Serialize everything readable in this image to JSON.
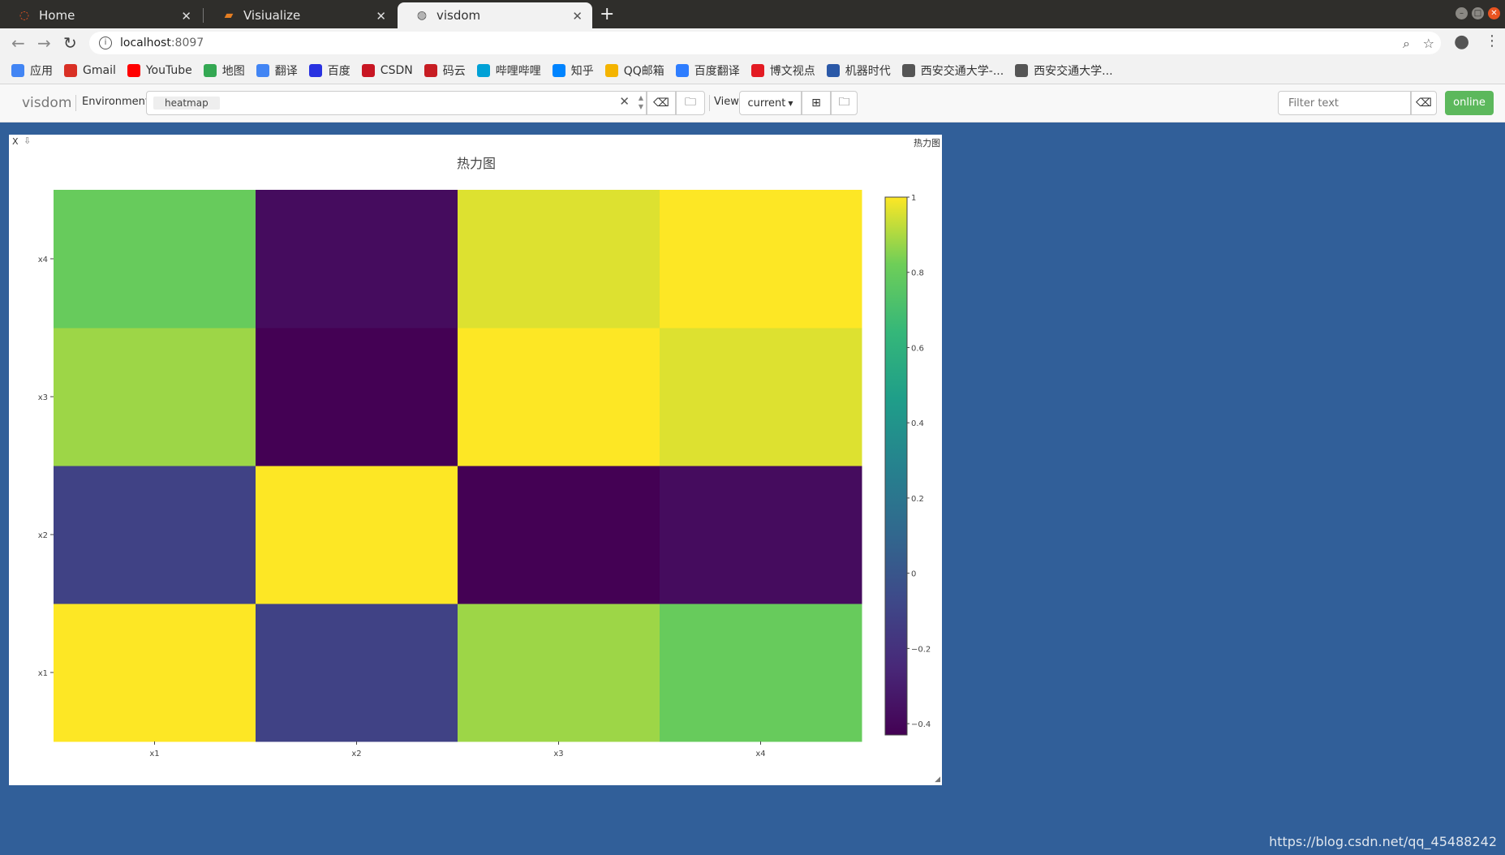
{
  "browser": {
    "tabs": [
      {
        "label": "Home",
        "icon": "ubuntu-icon"
      },
      {
        "label": "Visiualize",
        "icon": "book-icon"
      },
      {
        "label": "visdom",
        "icon": "globe-icon"
      }
    ],
    "url_host": "localhost",
    "url_port": ":8097",
    "bookmarks": [
      {
        "label": "应用",
        "icon": "apps-grid-icon",
        "color": "#4285f4"
      },
      {
        "label": "Gmail",
        "icon": "gmail-icon",
        "color": "#d93025"
      },
      {
        "label": "YouTube",
        "icon": "youtube-icon",
        "color": "#ff0000"
      },
      {
        "label": "地图",
        "icon": "maps-icon",
        "color": "#34a853"
      },
      {
        "label": "翻译",
        "icon": "translate-icon",
        "color": "#4285f4"
      },
      {
        "label": "百度",
        "icon": "baidu-paw-icon",
        "color": "#2932e1"
      },
      {
        "label": "CSDN",
        "icon": "csdn-icon",
        "color": "#c81623"
      },
      {
        "label": "码云",
        "icon": "gitee-icon",
        "color": "#c71d23"
      },
      {
        "label": "哔哩哔哩",
        "icon": "bilibili-icon",
        "color": "#00a1d6"
      },
      {
        "label": "知乎",
        "icon": "zhihu-icon",
        "color": "#0084ff"
      },
      {
        "label": "QQ邮箱",
        "icon": "qqmail-icon",
        "color": "#f4b400"
      },
      {
        "label": "百度翻译",
        "icon": "baidu-translate-icon",
        "color": "#2e7dff"
      },
      {
        "label": "博文视点",
        "icon": "bowen-icon",
        "color": "#e31b23"
      },
      {
        "label": "机器时代",
        "icon": "robot-icon",
        "color": "#2b59a8"
      },
      {
        "label": "西安交通大学-...",
        "icon": "globe-icon",
        "color": "#555555"
      },
      {
        "label": "西安交通大学...",
        "icon": "globe-icon",
        "color": "#555555"
      }
    ]
  },
  "visdom": {
    "brand": "visdom",
    "environment_label": "Environment",
    "environment_chip": "heatmap",
    "view_label": "View",
    "view_select": "current",
    "filter_placeholder": "Filter text",
    "status": "online"
  },
  "pane": {
    "close": "X",
    "title": "热力图"
  },
  "chart_data": {
    "type": "heatmap",
    "title": "热力图",
    "x": [
      "x1",
      "x2",
      "x3",
      "x4"
    ],
    "y": [
      "x1",
      "x2",
      "x3",
      "x4"
    ],
    "z": [
      [
        1.0,
        -0.11,
        0.88,
        0.8
      ],
      [
        -0.11,
        1.0,
        -0.43,
        -0.38
      ],
      [
        0.88,
        -0.43,
        1.0,
        0.96
      ],
      [
        0.8,
        -0.38,
        0.96,
        1.0
      ]
    ],
    "colorscale": "viridis",
    "zrange": [
      -0.43,
      1.0
    ],
    "colorbar_ticks": [
      1,
      0.8,
      0.6,
      0.4,
      0.2,
      0,
      -0.2,
      -0.4
    ],
    "colorbar_tick_labels": [
      "1",
      "0.8",
      "0.6",
      "0.4",
      "0.2",
      "0",
      "−0.2",
      "−0.4"
    ]
  },
  "watermark": "https://blog.csdn.net/qq_45488242"
}
